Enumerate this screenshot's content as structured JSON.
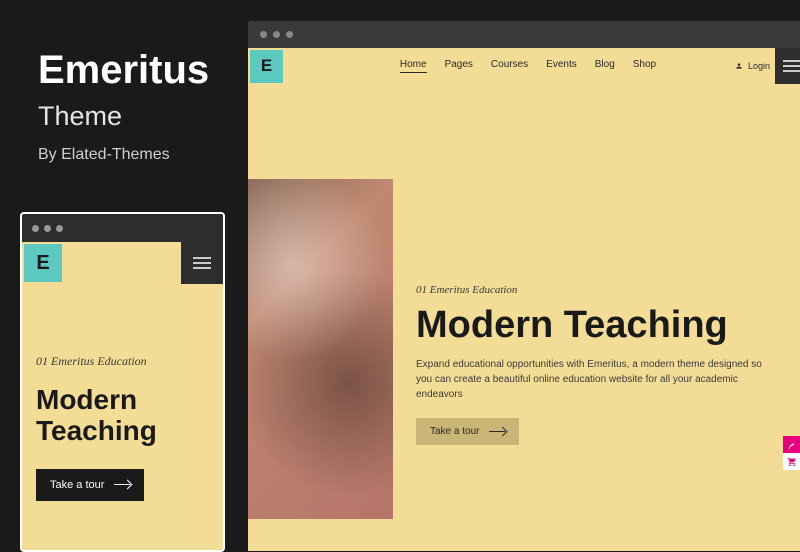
{
  "info": {
    "title": "Emeritus",
    "subtitle": "Theme",
    "author": "By Elated-Themes"
  },
  "logo_letter": "E",
  "nav": {
    "items": [
      "Home",
      "Pages",
      "Courses",
      "Events",
      "Blog",
      "Shop"
    ],
    "active_index": 0
  },
  "login_label": "Login",
  "hero": {
    "eyebrow": "01 Emeritus Education",
    "heading": "Modern Teaching",
    "description": "Expand educational opportunities with Emeritus, a modern theme designed so you can create a beautiful online education website for all your academic endeavors",
    "cta_label": "Take a tour"
  },
  "mobile": {
    "eyebrow": "01 Emeritus Education",
    "heading": "Modern Teaching",
    "cta_label": "Take a tour"
  },
  "colors": {
    "page_bg": "#1a1a1a",
    "theme_bg": "#f3dc95",
    "accent": "#5cc9c0",
    "badge_pink": "#e6007e"
  }
}
